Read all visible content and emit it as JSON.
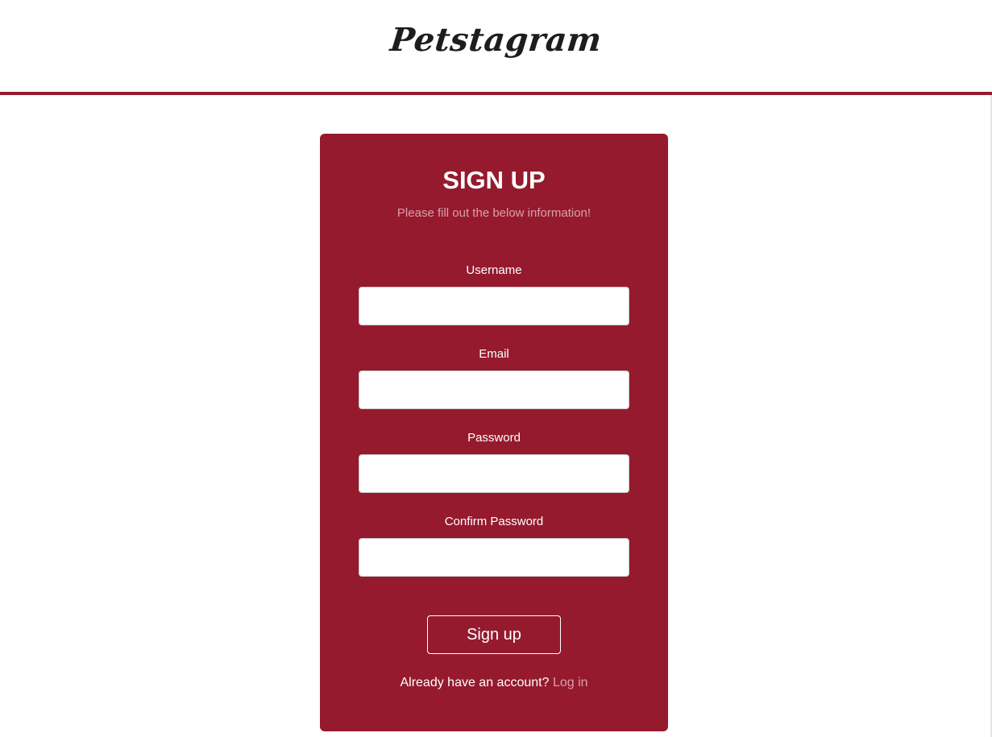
{
  "header": {
    "logo_text": "Petstagram"
  },
  "signup_form": {
    "title": "SIGN UP",
    "subtitle": "Please fill out the below information!",
    "fields": [
      {
        "label": "Username",
        "value": "",
        "placeholder": ""
      },
      {
        "label": "Email",
        "value": "",
        "placeholder": ""
      },
      {
        "label": "Password",
        "value": "",
        "placeholder": ""
      },
      {
        "label": "Confirm Password",
        "value": "",
        "placeholder": ""
      }
    ],
    "submit_label": "Sign up",
    "login_prompt": "Already have an account?",
    "login_link_label": "Log in"
  },
  "colors": {
    "brand": "#951a2e",
    "link": "#dba0ab",
    "card_text": "#ffffff",
    "logo_text": "#1d1d1d"
  }
}
